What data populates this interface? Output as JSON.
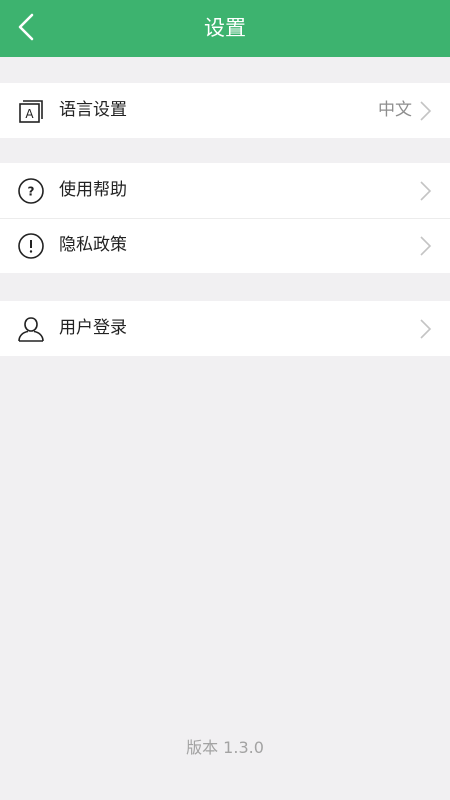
{
  "header": {
    "title": "设置"
  },
  "groups": [
    {
      "items": [
        {
          "label": "语言设置",
          "value": "中文",
          "icon": "language-icon"
        }
      ]
    },
    {
      "items": [
        {
          "label": "使用帮助",
          "icon": "help-icon"
        },
        {
          "label": "隐私政策",
          "icon": "notice-icon"
        }
      ]
    },
    {
      "items": [
        {
          "label": "用户登录",
          "icon": "user-icon"
        }
      ]
    }
  ],
  "footer": {
    "version": "版本 1.3.0"
  },
  "colors": {
    "header_bg": "#3db36f",
    "page_bg": "#f1f0f2"
  }
}
